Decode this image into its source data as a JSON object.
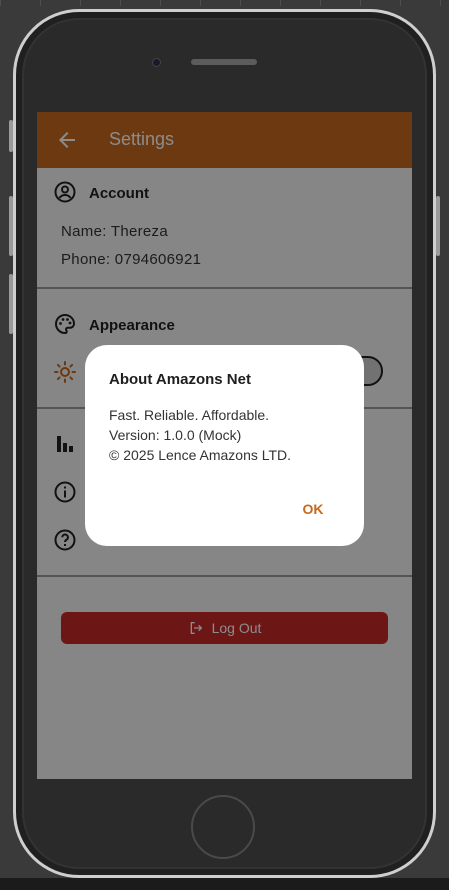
{
  "app": {
    "title": "Settings"
  },
  "account": {
    "section_title": "Account",
    "name_line": "Name: Thereza",
    "phone_line": "Phone: 0794606921"
  },
  "appearance": {
    "section_title": "Appearance"
  },
  "actions": {
    "logout_label": "Log Out"
  },
  "dialog": {
    "title": "About Amazons Net",
    "line1": "Fast. Reliable. Affordable.",
    "line2": "Version: 1.0.0 (Mock)",
    "line3": "© 2025 Lence Amazons LTD.",
    "ok_label": "OK"
  },
  "colors": {
    "brand": "#c5691e",
    "logout": "#c62828",
    "scrim": "rgba(0,0,0,0.45)"
  },
  "icons": {
    "back": "arrow-back-icon",
    "account": "account-circle-icon",
    "appearance": "palette-icon",
    "theme": "sun-icon",
    "stats": "bar-chart-icon",
    "about": "info-icon",
    "help": "help-icon",
    "logout": "logout-icon"
  }
}
